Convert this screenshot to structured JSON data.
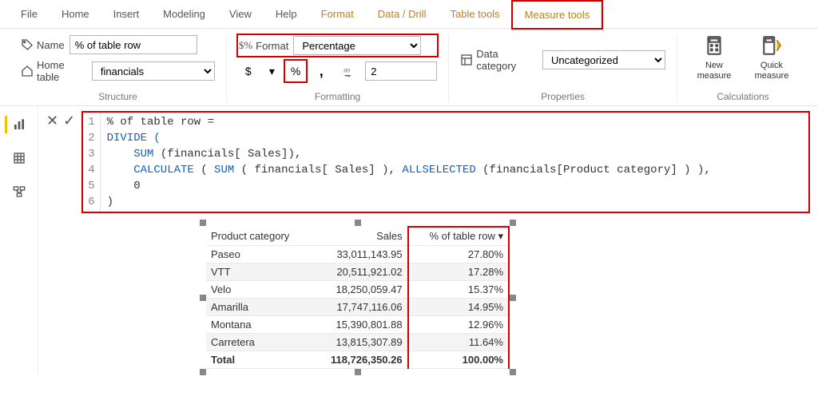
{
  "tabs": [
    "File",
    "Home",
    "Insert",
    "Modeling",
    "View",
    "Help",
    "Format",
    "Data / Drill",
    "Table tools",
    "Measure tools"
  ],
  "ribbon": {
    "name_label": "Name",
    "name_value": "% of table row",
    "home_table_label": "Home table",
    "home_table_value": "financials",
    "format_label": "Format",
    "format_value": "Percentage",
    "decimal_value": "2",
    "datacat_label": "Data category",
    "datacat_value": "Uncategorized",
    "new_measure": "New\nmeasure",
    "quick_measure": "Quick\nmeasure",
    "group_structure": "Structure",
    "group_formatting": "Formatting",
    "group_properties": "Properties",
    "group_calculations": "Calculations"
  },
  "formula": {
    "line1": "% of table row =",
    "line2": "DIVIDE (",
    "line3_pre": "    ",
    "line3_fn": "SUM",
    "line3_rest": " (financials[ Sales]),",
    "line4_pre": "    ",
    "line4_fn1": "CALCULATE",
    "line4_mid1": " ( ",
    "line4_fn2": "SUM",
    "line4_mid2": " ( financials[ Sales] ), ",
    "line4_fn3": "ALLSELECTED",
    "line4_mid3": " (financials[Product category] ) ),",
    "line5": "    0",
    "line6": ")"
  },
  "table": {
    "headers": [
      "Product category",
      "Sales",
      "% of table row"
    ],
    "rows": [
      [
        "Paseo",
        "33,011,143.95",
        "27.80%"
      ],
      [
        "VTT",
        "20,511,921.02",
        "17.28%"
      ],
      [
        "Velo",
        "18,250,059.47",
        "15.37%"
      ],
      [
        "Amarilla",
        "17,747,116.06",
        "14.95%"
      ],
      [
        "Montana",
        "15,390,801.88",
        "12.96%"
      ],
      [
        "Carretera",
        "13,815,307.89",
        "11.64%"
      ]
    ],
    "total": [
      "Total",
      "118,726,350.26",
      "100.00%"
    ]
  }
}
